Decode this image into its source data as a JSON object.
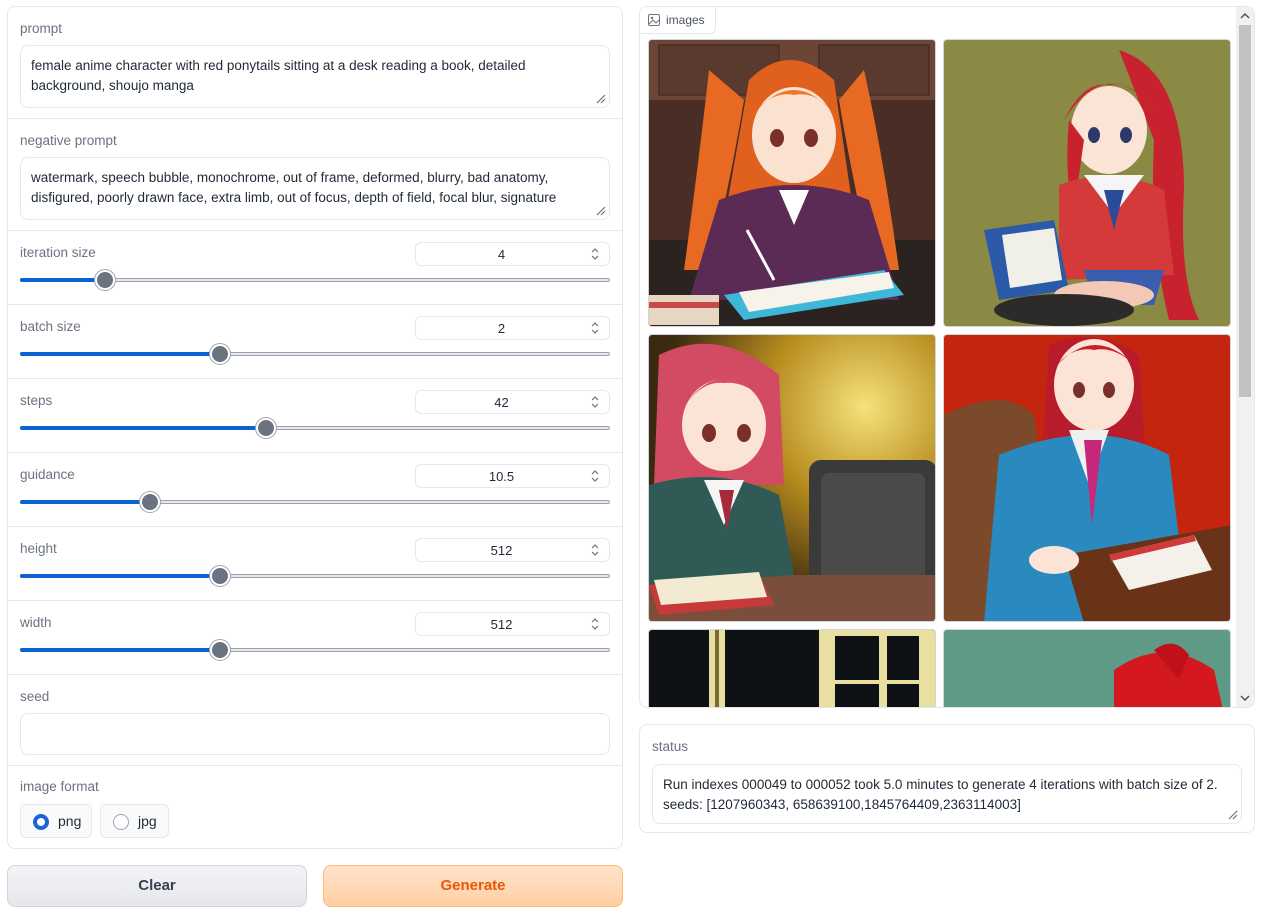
{
  "prompt": {
    "label": "prompt",
    "value": "female anime character with red ponytails sitting at a desk reading a book, detailed background, shoujo manga"
  },
  "negative_prompt": {
    "label": "negative prompt",
    "value": "watermark, speech bubble, monochrome, out of frame, deformed, blurry, bad anatomy, disfigured, poorly drawn face, extra limb, out of focus, depth of field, focal blur, signature"
  },
  "sliders": [
    {
      "label": "iteration size",
      "value": "4",
      "fraction": 0.144
    },
    {
      "label": "batch size",
      "value": "2",
      "fraction": 0.339
    },
    {
      "label": "steps",
      "value": "42",
      "fraction": 0.417
    },
    {
      "label": "guidance",
      "value": "10.5",
      "fraction": 0.22
    },
    {
      "label": "height",
      "value": "512",
      "fraction": 0.339
    },
    {
      "label": "width",
      "value": "512",
      "fraction": 0.339
    }
  ],
  "seed": {
    "label": "seed",
    "value": ""
  },
  "image_format": {
    "label": "image format",
    "options": [
      "png",
      "jpg"
    ],
    "selected": "png"
  },
  "buttons": {
    "clear": "Clear",
    "generate": "Generate"
  },
  "gallery": {
    "label": "images",
    "images": [
      "image-1",
      "image-2",
      "image-3",
      "image-4",
      "image-5",
      "image-6"
    ]
  },
  "status": {
    "label": "status",
    "text": "Run indexes 000049 to 000052 took 5.0 minutes to generate 4 iterations with batch size of 2. seeds: [1207960343, 658639100,1845764409,2363114003]"
  },
  "colors": {
    "accent": "#0b63d6",
    "generate_text": "#ea580c",
    "generate_bg": "#ffd7b0"
  }
}
